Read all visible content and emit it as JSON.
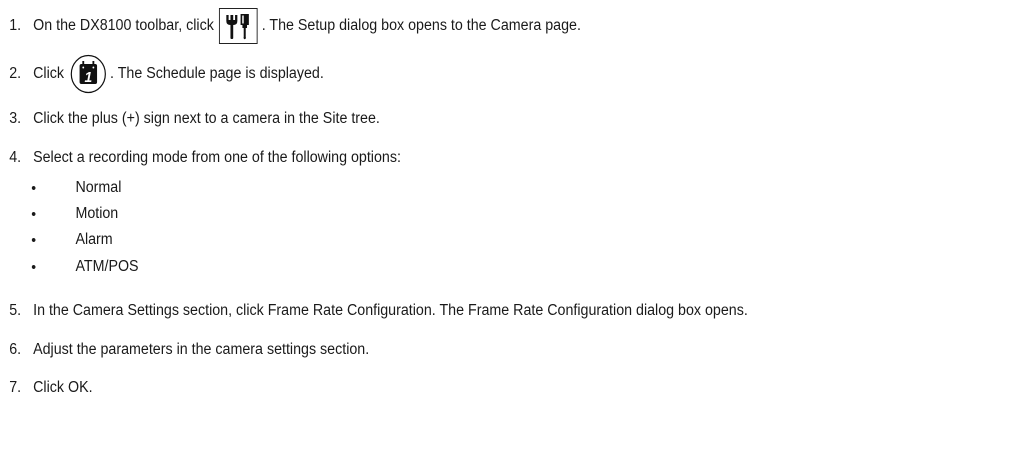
{
  "steps": [
    {
      "number": "1.",
      "before": "On the DX8100 toolbar, click",
      "icon": "setup-tools-icon",
      "after": ". The Setup dialog box opens to the Camera page."
    },
    {
      "number": "2.",
      "before": "Click",
      "icon": "schedule-calendar-icon",
      "calendar_digit": "1",
      "after": ". The Schedule page is displayed."
    },
    {
      "number": "3.",
      "text": "Click the plus (+) sign next to a camera in the Site tree."
    },
    {
      "number": "4.",
      "text": "Select a recording mode from one of the following options:"
    },
    {
      "number": "5.",
      "text": "In the Camera Settings section, click Frame Rate Configuration. The Frame Rate Configuration dialog box opens."
    },
    {
      "number": "6.",
      "text": "Adjust the parameters in the camera settings section."
    },
    {
      "number": "7.",
      "text": "Click OK."
    }
  ],
  "bullet_symbol": "•",
  "recording_modes": [
    "Normal",
    "Motion",
    "Alarm",
    "ATM/POS"
  ]
}
